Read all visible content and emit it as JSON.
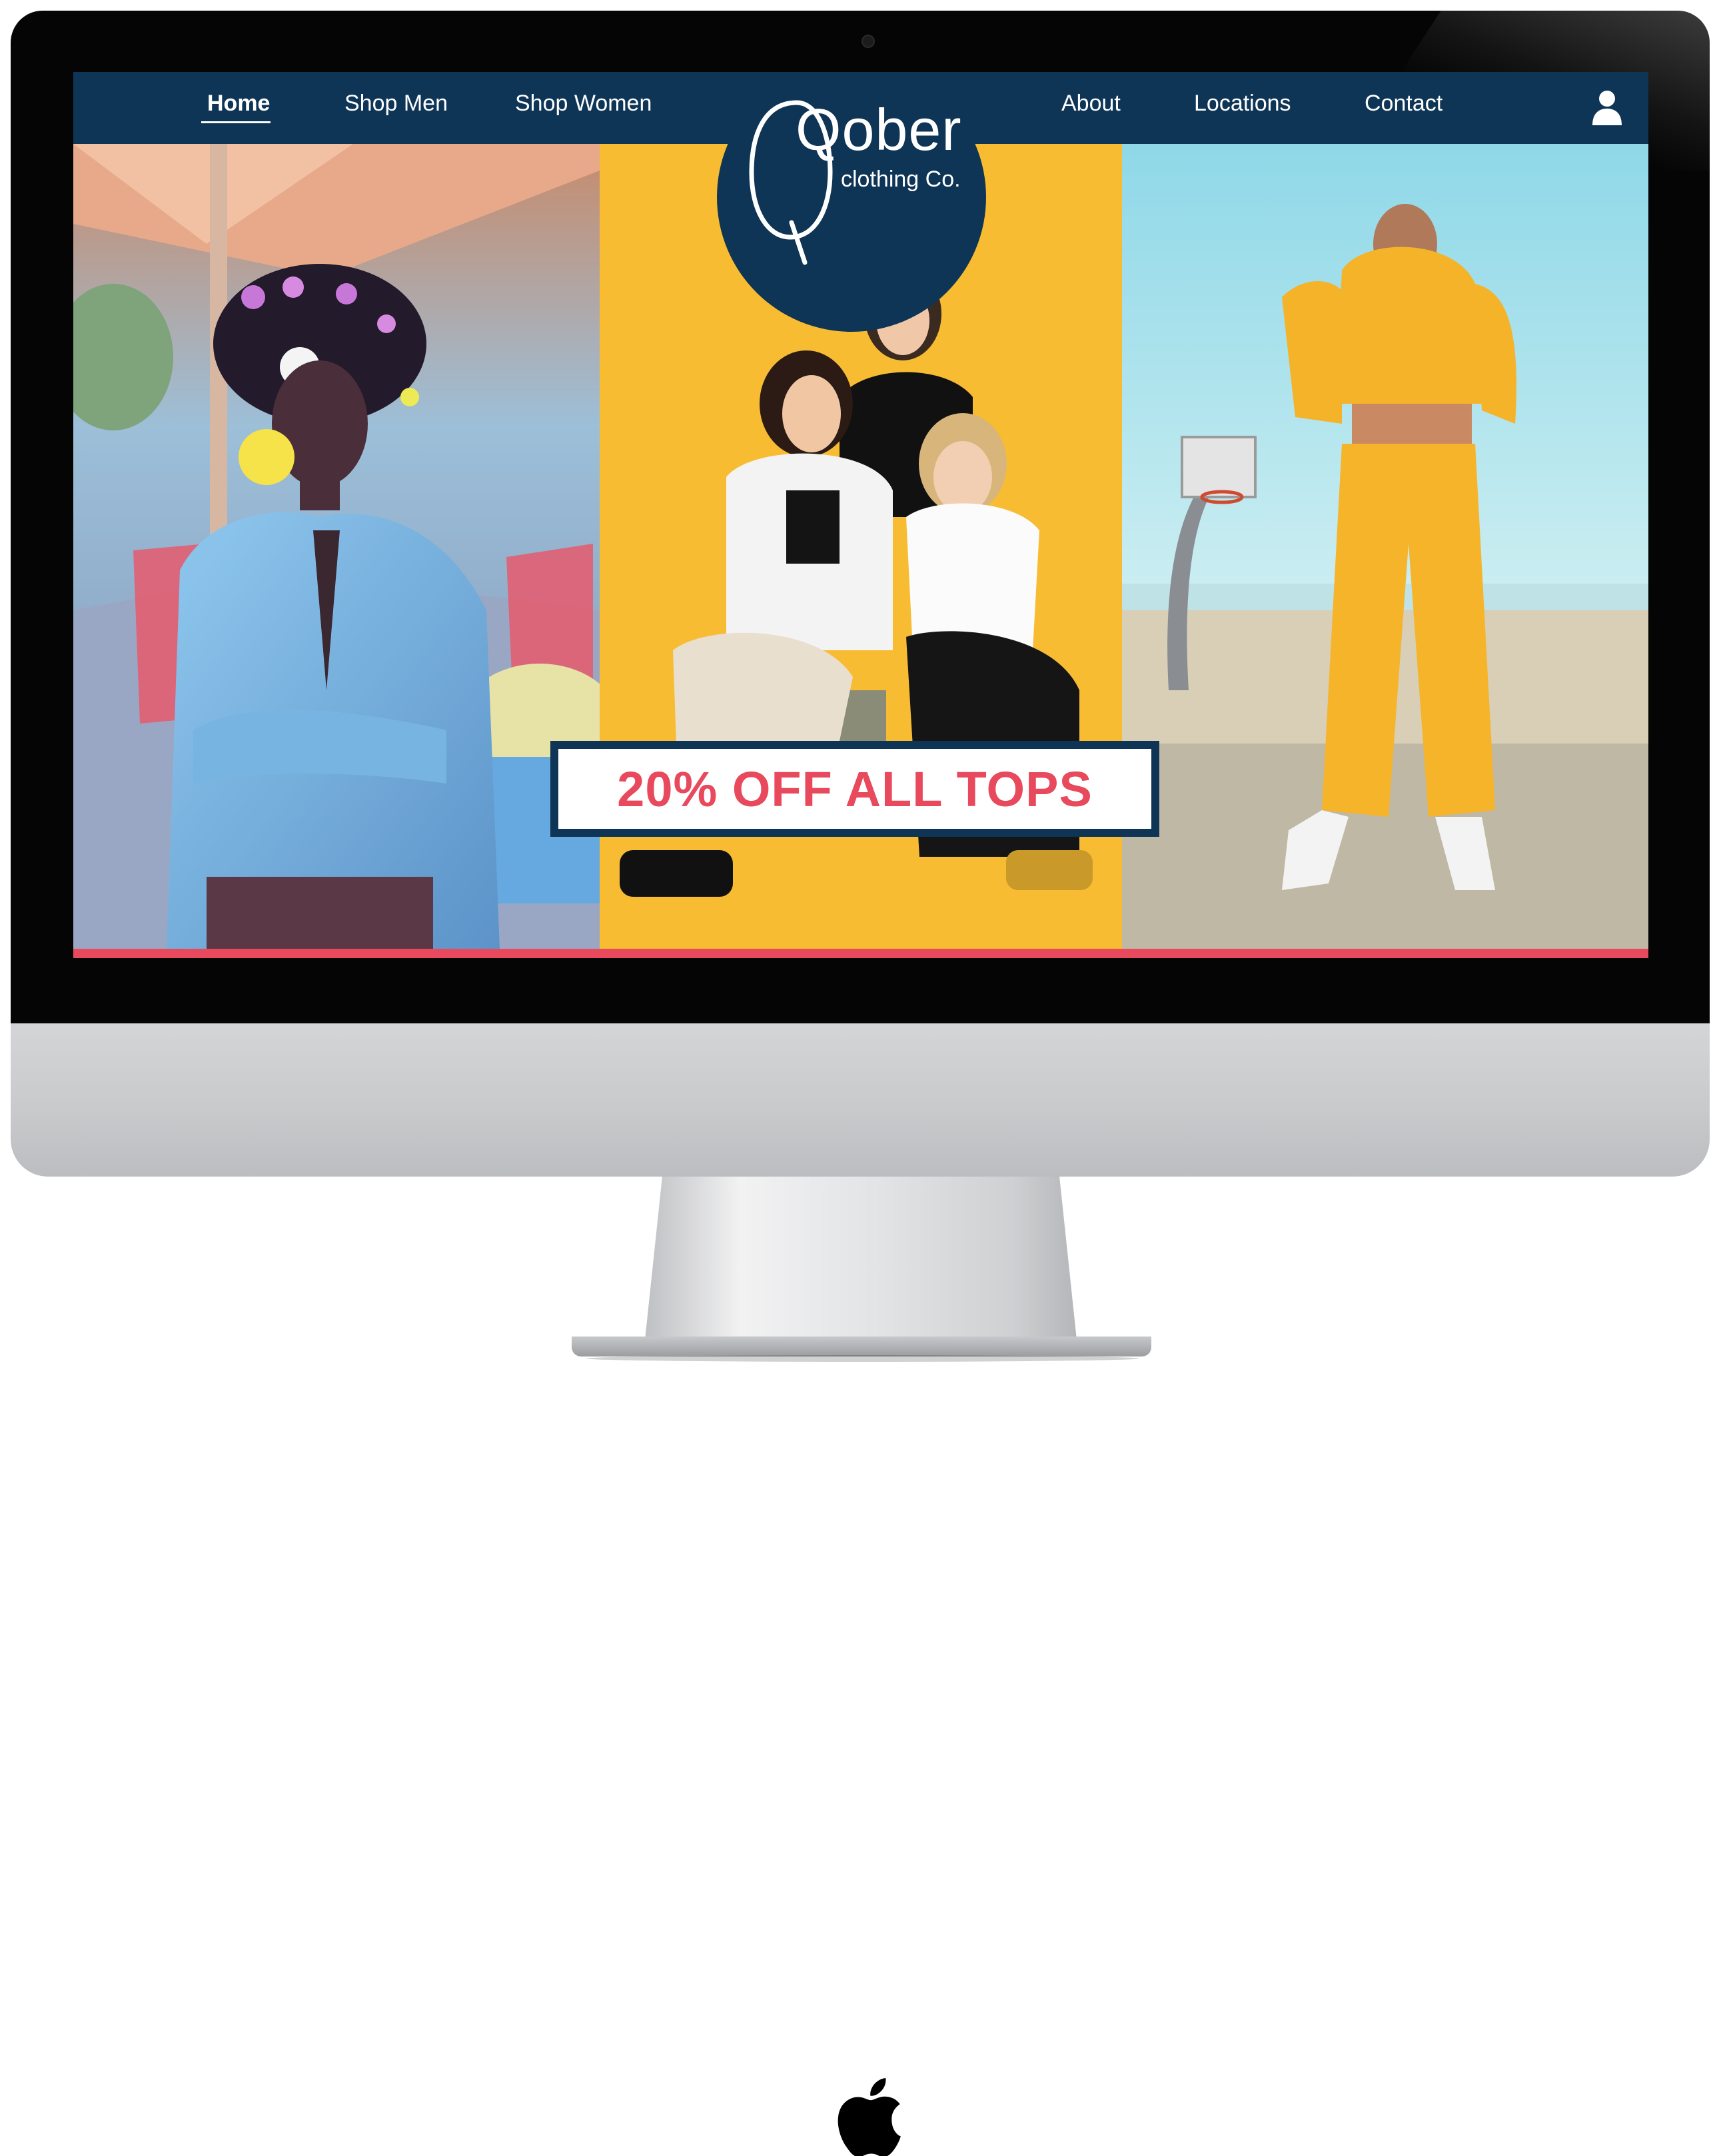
{
  "nav": {
    "left": [
      "Home",
      "Shop Men",
      "Shop Women"
    ],
    "right": [
      "About",
      "Locations",
      "Contact"
    ],
    "active": "Home",
    "account_icon": "user-icon"
  },
  "logo": {
    "main": "Qober",
    "sub": "clothing Co."
  },
  "promo": {
    "text": "20% OFF ALL TOPS"
  },
  "hardware": {
    "brand_icon": "apple-logo"
  },
  "colors": {
    "navy": "#0e3556",
    "accent": "#e8495c",
    "promo_bg": "#ffffff"
  }
}
